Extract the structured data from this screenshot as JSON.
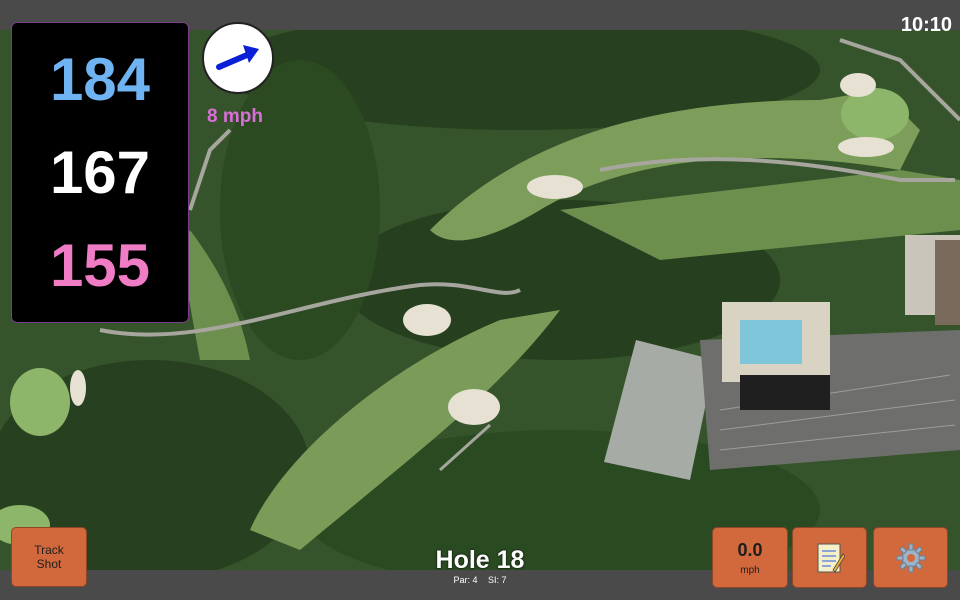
{
  "status": {
    "time": "10:10"
  },
  "distances": {
    "back": "184",
    "middle": "167",
    "front": "155"
  },
  "colors": {
    "back": "#6fb3f2",
    "middle": "#ffffff",
    "front": "#f07cc6",
    "wind_text": "#d86fd6",
    "button": "#d2693c"
  },
  "wind": {
    "speed_label": "8 mph",
    "arrow_icon": "arrow-right-icon"
  },
  "buttons": {
    "track_shot": "Track\nShot",
    "speed_value": "0.0",
    "speed_unit": "mph",
    "notes_icon": "notepad-icon",
    "settings_icon": "gear-icon"
  },
  "hole": {
    "title": "Hole 18",
    "par": "Par: 4",
    "si": "SI: 7"
  }
}
